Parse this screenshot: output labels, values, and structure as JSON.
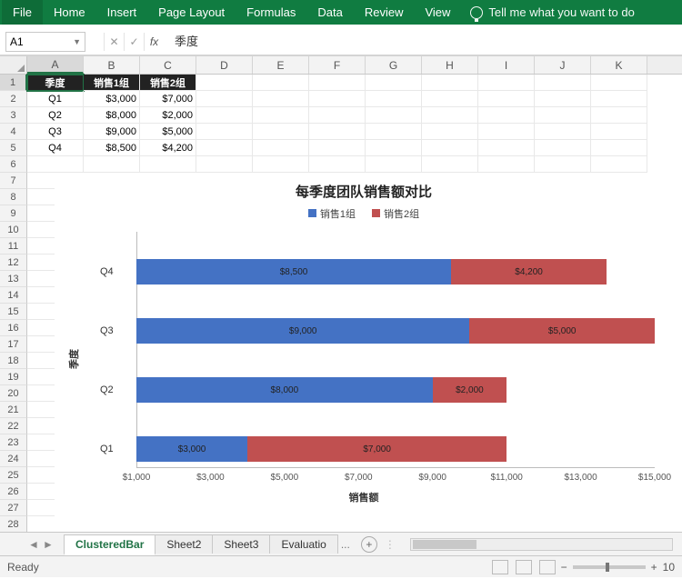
{
  "ribbon": {
    "tabs": [
      "File",
      "Home",
      "Insert",
      "Page Layout",
      "Formulas",
      "Data",
      "Review",
      "View"
    ],
    "tell": "Tell me what you want to do"
  },
  "namebox": "A1",
  "fx": {
    "cancel": "✕",
    "confirm": "✓",
    "fx": "fx",
    "value": "季度"
  },
  "columns": [
    "A",
    "B",
    "C",
    "D",
    "E",
    "F",
    "G",
    "H",
    "I",
    "J",
    "K"
  ],
  "table": {
    "headers": [
      "季度",
      "销售1组",
      "销售2组"
    ],
    "rows": [
      [
        "Q1",
        "$3,000",
        "$7,000"
      ],
      [
        "Q2",
        "$8,000",
        "$2,000"
      ],
      [
        "Q3",
        "$9,000",
        "$5,000"
      ],
      [
        "Q4",
        "$8,500",
        "$4,200"
      ]
    ]
  },
  "chart_data": {
    "type": "bar",
    "title": "每季度团队销售额对比",
    "xlabel": "销售额",
    "ylabel": "季度",
    "xlim": [
      1000,
      15000
    ],
    "xticks": [
      "$1,000",
      "$3,000",
      "$5,000",
      "$7,000",
      "$9,000",
      "$11,000",
      "$13,000",
      "$15,000"
    ],
    "categories": [
      "Q1",
      "Q2",
      "Q3",
      "Q4"
    ],
    "series": [
      {
        "name": "销售1组",
        "color": "#4472c4",
        "values": [
          3000,
          8000,
          9000,
          8500
        ],
        "labels": [
          "$3,000",
          "$8,000",
          "$9,000",
          "$8,500"
        ]
      },
      {
        "name": "销售2组",
        "color": "#c05050",
        "values": [
          7000,
          2000,
          5000,
          4200
        ],
        "labels": [
          "$7,000",
          "$2,000",
          "$5,000",
          "$4,200"
        ]
      }
    ],
    "stacked": true
  },
  "sheets": {
    "tabs": [
      "ClusteredBar",
      "Sheet2",
      "Sheet3",
      "Evaluatio"
    ],
    "ellipsis": "...",
    "active": 0
  },
  "status": {
    "ready": "Ready",
    "zoom": "10"
  }
}
